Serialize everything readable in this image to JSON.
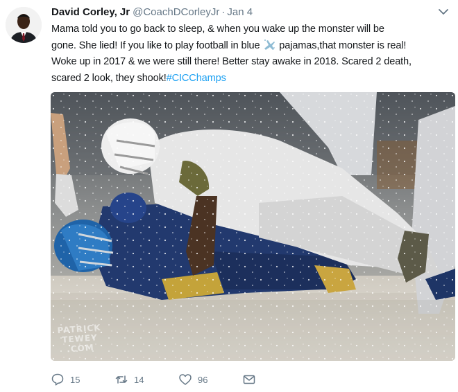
{
  "tweet": {
    "author_name": "David Corley, Jr",
    "handle": "@CoachDCorleyJr",
    "separator": "·",
    "date": "Jan 4",
    "text_line1": "Mama told you to go back to sleep, & when you wake up the monster will be",
    "text_line2a": "gone. She lied! If you like to play football in blue ",
    "text_line2b": " pajamas,that monster is real!",
    "text_line3": "Woke up in 2017 & we were still there! Better stay awake in 2018. Scared 2 death,",
    "text_line4": "scared 2 look, they shook!",
    "hashtag": "#CICChamps",
    "emoji_icon": "airplane-emoji",
    "media_watermark": "PATRICK TEWEY .COM"
  },
  "actions": {
    "reply_count": "15",
    "retweet_count": "14",
    "like_count": "96"
  },
  "colors": {
    "text": "#14171a",
    "secondary": "#657786",
    "link": "#1da1f2"
  }
}
